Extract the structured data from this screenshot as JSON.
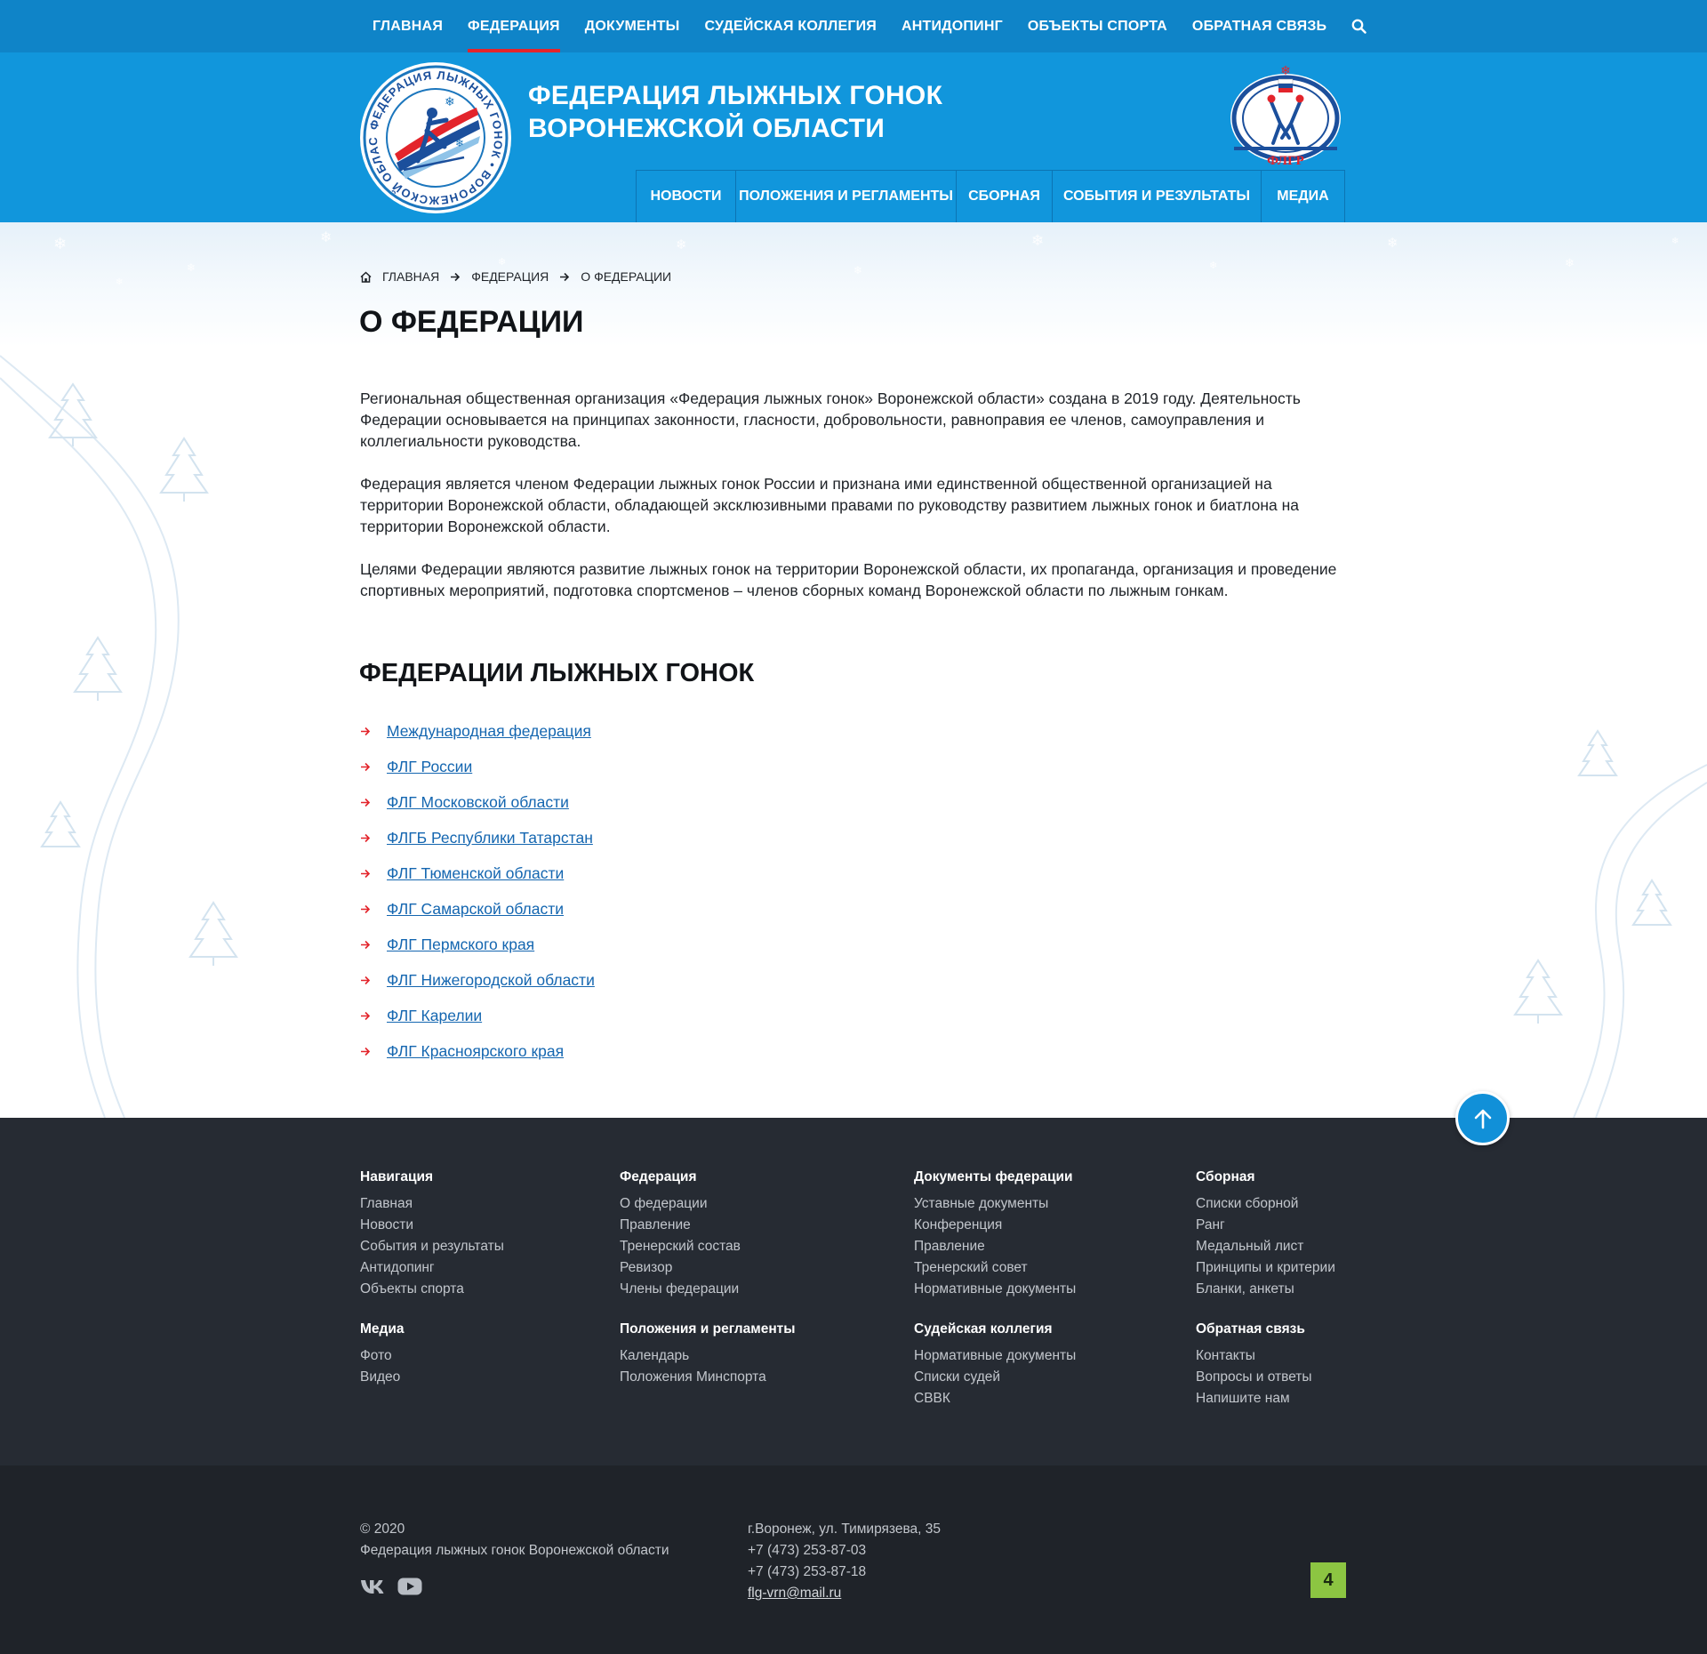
{
  "topnav": {
    "items": [
      {
        "label": "ГЛАВНАЯ"
      },
      {
        "label": "ФЕДЕРАЦИЯ"
      },
      {
        "label": "ДОКУМЕНТЫ"
      },
      {
        "label": "СУДЕЙСКАЯ КОЛЛЕГИЯ"
      },
      {
        "label": "АНТИДОПИНГ"
      },
      {
        "label": "ОБЪЕКТЫ СПОРТА"
      },
      {
        "label": "ОБРАТНАЯ СВЯЗЬ"
      }
    ],
    "active": "ФЕДЕРАЦИЯ",
    "search_icon": "search-icon"
  },
  "header": {
    "title_line1": "ФЕДЕРАЦИЯ ЛЫЖНЫХ ГОНОК",
    "title_line2": "ВОРОНЕЖСКОЙ ОБЛАСТИ",
    "logo_left_ring_text": "ФЕДЕРАЦИЯ ЛЫЖНЫХ ГОНОК • ВОРОНЕЖСКОЙ ОБЛАСТИ",
    "logo_right_text": "ФЛГР"
  },
  "mainnav": {
    "items": [
      {
        "label": "НОВОСТИ"
      },
      {
        "label": "ПОЛОЖЕНИЯ И РЕГЛАМЕНТЫ"
      },
      {
        "label": "СБОРНАЯ"
      },
      {
        "label": "СОБЫТИЯ И РЕЗУЛЬТАТЫ"
      },
      {
        "label": "МЕДИА"
      }
    ]
  },
  "breadcrumb": {
    "home": "ГЛАВНАЯ",
    "section": "ФЕДЕРАЦИЯ",
    "current": "О ФЕДЕРАЦИИ"
  },
  "page": {
    "title": "О ФЕДЕРАЦИИ",
    "paragraphs": [
      "Региональная общественная организация «Федерация лыжных гонок» Воронежской области» создана в 2019 году. Деятельность Федерации основывается на принципах законности, гласности, добровольности, равноправия ее членов, самоуправления и коллегиальности руководства.",
      "Федерация является членом Федерации лыжных гонок России и признана ими единственной общественной организацией на территории Воронежской области, обладающей эксклюзивными правами по руководству развитием лыжных гонок и биатлона на территории Воронежской области.",
      "Целями Федерации являются развитие лыжных гонок на территории Воронежской области, их пропаганда, организация и проведение спортивных мероприятий, подготовка спортсменов – членов сборных команд Воронежской области по лыжным гонкам."
    ],
    "section_title": "ФЕДЕРАЦИИ ЛЫЖНЫХ ГОНОК",
    "federations": [
      "Международная федерация",
      "ФЛГ России",
      "ФЛГ Московской области",
      "ФЛГБ Республики Татарстан",
      "ФЛГ Тюменской области",
      "ФЛГ Самарской области",
      "ФЛГ Пермского края",
      "ФЛГ Нижегородской области",
      "ФЛГ Карелии",
      "ФЛГ Красноярского края"
    ]
  },
  "footer": {
    "columns": [
      {
        "title": "Навигация",
        "links": [
          "Главная",
          "Новости",
          "События и результаты",
          "Антидопинг",
          "Объекты спорта"
        ]
      },
      {
        "title": "Федерация",
        "links": [
          "О федерации",
          "Правление",
          "Тренерский состав",
          "Ревизор",
          "Члены федерации"
        ]
      },
      {
        "title": "Документы федерации",
        "links": [
          "Уставные документы",
          "Конференция",
          "Правление",
          "Тренерский совет",
          "Нормативные документы"
        ]
      },
      {
        "title": "Сборная",
        "links": [
          "Списки сборной",
          "Ранг",
          "Медальный лист",
          "Принципы и критерии",
          "Бланки, анкеты"
        ]
      },
      {
        "title": "Медиа",
        "links": [
          "Фото",
          "Видео"
        ]
      },
      {
        "title": "Положения и регламенты",
        "links": [
          "Календарь",
          "Положения Минспорта"
        ]
      },
      {
        "title": "Судейская коллегия",
        "links": [
          "Нормативные документы",
          "Списки судей",
          "СВВК"
        ]
      },
      {
        "title": "Обратная связь",
        "links": [
          "Контакты",
          "Вопросы и ответы",
          "Напишите нам"
        ]
      }
    ],
    "copyright": "© 2020",
    "org_name": "Федерация лыжных гонок Воронежской области",
    "address": "г.Воронеж, ул. Тимирязева, 35",
    "phone1": "+7 (473) 253-87-03",
    "phone2": "+7 (473) 253-87-18",
    "email": "flg-vrn@mail.ru",
    "badge": "4",
    "social_icons": [
      "vk-icon",
      "youtube-icon"
    ]
  },
  "colors": {
    "topbar": "#0f84c8",
    "header": "#1196dc",
    "accent_red": "#e3242b",
    "link": "#1466b0",
    "footer": "#262b33",
    "footer_bottom": "#1f2329",
    "badge": "#8cc542"
  }
}
